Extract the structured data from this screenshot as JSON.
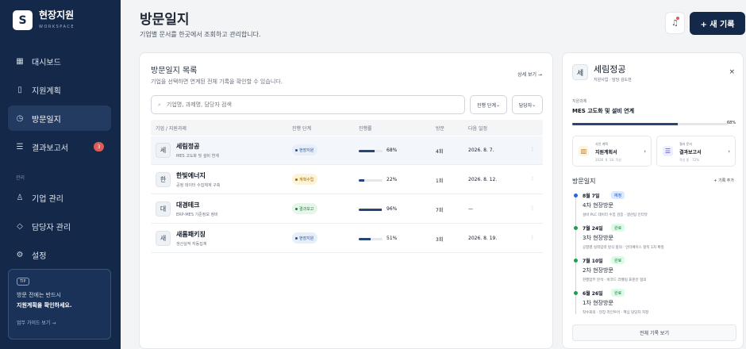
{
  "app": {
    "logo_letter": "S",
    "name": "현장지원",
    "subtitle": "WORKSPACE"
  },
  "sidebar": {
    "items": [
      {
        "label": "대시보드",
        "icon": "grid-icon"
      },
      {
        "label": "지원계획",
        "icon": "book-icon"
      },
      {
        "label": "방문일지",
        "icon": "clock-icon"
      },
      {
        "label": "결과보고서",
        "icon": "document-icon",
        "badge": "3"
      },
      {
        "label": "기업 관리",
        "icon": "user-icon"
      },
      {
        "label": "담당자 관리",
        "icon": "diamond-icon"
      },
      {
        "label": "설정",
        "icon": "gear-icon"
      }
    ],
    "section_label": "관리",
    "tip": {
      "badge": "TIP",
      "line1": "방문 전에는 반드시",
      "line2": "지원계획을 확인하세요.",
      "link": "업무 가이드 보기 →"
    }
  },
  "header": {
    "title": "방문일지",
    "subtitle": "기업별 문서를 한곳에서 조회하고 관리합니다.",
    "new_button": "+ 새 기록"
  },
  "list": {
    "title": "방문일지 목록",
    "subtitle": "기업을 선택하면 연계된 전체 기록을 확인할 수 있습니다.",
    "more": "상세 보기 →",
    "search_placeholder": "기업명, 과제명, 담당자 검색",
    "filter_status": "진행 단계",
    "filter_owner": "담당자",
    "columns": [
      "기업 / 지원과제",
      "진행 단계",
      "진행률",
      "방문",
      "다음 일정"
    ],
    "rows": [
      {
        "avatar": "세",
        "company": "세림정공",
        "project": "MES 고도화 및 설비 연계",
        "status": "현장지원",
        "progress": 68,
        "pct": "68%",
        "visits": "4회",
        "next": "2026. 8. 7."
      },
      {
        "avatar": "한",
        "company": "한빛에너지",
        "project": "공정 데이터 수집체계 구축",
        "status": "계획수립",
        "progress": 22,
        "pct": "22%",
        "visits": "1회",
        "next": "2026. 8. 12."
      },
      {
        "avatar": "대",
        "company": "대경테크",
        "project": "ERP-MES 기준정보 정비",
        "status": "결과보고",
        "progress": 96,
        "pct": "96%",
        "visits": "7회",
        "next": "—"
      },
      {
        "avatar": "새",
        "company": "새롬패키징",
        "project": "생산실적 자동집계",
        "status": "현장지원",
        "progress": 51,
        "pct": "51%",
        "visits": "3회",
        "next": "2026. 8. 19."
      }
    ],
    "menu_icon": "⋮"
  },
  "detail": {
    "avatar": "세",
    "title": "세림정공",
    "subtitle": "지원사업 · 담당 김도현",
    "close": "×",
    "project_label": "지원과제",
    "project": "MES 고도화 및 설비 연계",
    "progress": 68,
    "pct": "68%",
    "docs": [
      {
        "label": "사전 계획",
        "title": "지원계획서",
        "meta": "2026. 6. 18. 작성",
        "icon": "book-icon"
      },
      {
        "label": "결과 문서",
        "title": "결과보고서",
        "meta": "작성 중 · 72%",
        "icon": "document-icon"
      }
    ],
    "history_title": "방문일지",
    "history_add": "+ 기록 추가",
    "timeline": [
      {
        "date": "8월 7일",
        "badge": "예정",
        "title": "4차 현장방문",
        "note": "설비 PLC 데이터 수집 검증 · 생산팀 인터뷰",
        "badge_bg": "#dbeafe",
        "badge_color": "#1d4ed8",
        "dot": "#2563eb"
      },
      {
        "date": "7월 24일",
        "badge": "완료",
        "title": "3차 현장방문",
        "note": "공정별 실적입력 방식 합의 · 인터페이스 항목 1차 확정",
        "badge_bg": "#dcfce7",
        "badge_color": "#15803d",
        "dot": "#16a34a"
      },
      {
        "date": "7월 10일",
        "badge": "완료",
        "title": "2차 현장방문",
        "note": "현행업무 분석 · 바코드 라벨링 표준안 협의",
        "badge_bg": "#dcfce7",
        "badge_color": "#15803d",
        "dot": "#16a34a"
      },
      {
        "date": "6월 26일",
        "badge": "완료",
        "title": "1차 현장방문",
        "note": "착수회의 · 현장 라인투어 · 핵심 담당자 지정",
        "badge_bg": "#dcfce7",
        "badge_color": "#15803d",
        "dot": "#16a34a"
      }
    ],
    "all_button": "전체 기록 보기"
  },
  "colors": {
    "sidebar": "#14294a",
    "accent": "#274577",
    "alert": "#e05b55"
  }
}
